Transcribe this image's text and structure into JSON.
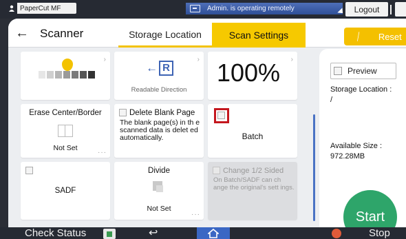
{
  "statusbar": {
    "app_name": "PaperCut MF",
    "remote_message": "Admin. is operating remotely",
    "logout_label": "Logout"
  },
  "header": {
    "back_icon": "arrow-left-icon",
    "title": "Scanner",
    "tabs": [
      {
        "label": "Storage Location",
        "active": false
      },
      {
        "label": "Scan Settings",
        "active": true
      }
    ],
    "reset_label": "Reset"
  },
  "tiles": {
    "direction": {
      "label": "Readable Direction"
    },
    "zoom": {
      "value": "100%"
    },
    "erase": {
      "title": "Erase Center/Border",
      "value": "Not Set"
    },
    "blank": {
      "title": "Delete Blank Page",
      "description": "The blank page(s) in th e scanned data is delet ed automatically."
    },
    "batch": {
      "label": "Batch"
    },
    "sadf": {
      "label": "SADF"
    },
    "divide": {
      "title": "Divide",
      "value": "Not Set"
    },
    "change": {
      "title": "Change 1/2 Sided",
      "description": "On Batch/SADF can ch ange the original's sett ings."
    }
  },
  "right_panel": {
    "preview_label": "Preview",
    "storage_location_label": "Storage Location :",
    "storage_location_value": "/",
    "available_size_label": "Available Size :",
    "available_size_value": "972.28MB",
    "start_label": "Start"
  },
  "bottombar": {
    "check_status_label": "Check Status",
    "stop_label": "Stop"
  },
  "colors": {
    "accent": "#f6c900",
    "start": "#2ea56a",
    "highlight": "#c4171e",
    "home": "#3a67c4"
  }
}
